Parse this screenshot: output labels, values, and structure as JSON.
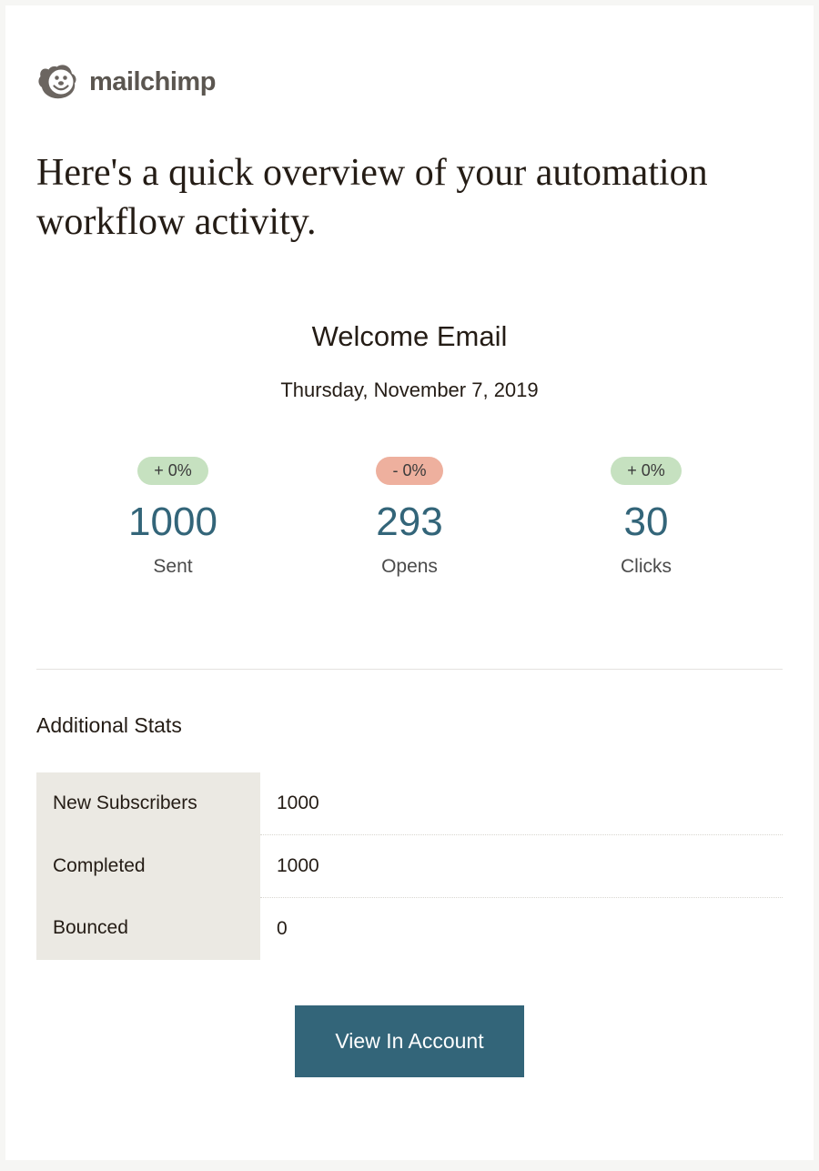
{
  "brand": {
    "name": "mailchimp",
    "icon": "monkey-icon"
  },
  "hero": "Here's a quick overview of your automation workflow activity.",
  "campaign": {
    "title": "Welcome Email",
    "date": "Thursday, November 7, 2019"
  },
  "metrics": {
    "sent": {
      "delta": "+ 0%",
      "delta_color": "green",
      "value": "1000",
      "label": "Sent"
    },
    "opens": {
      "delta": "- 0%",
      "delta_color": "red",
      "value": "293",
      "label": "Opens"
    },
    "clicks": {
      "delta": "+ 0%",
      "delta_color": "green",
      "value": "30",
      "label": "Clicks"
    }
  },
  "additional": {
    "heading": "Additional Stats",
    "rows": [
      {
        "key": "New Subscribers",
        "value": "1000"
      },
      {
        "key": "Completed",
        "value": "1000"
      },
      {
        "key": "Bounced",
        "value": "0"
      }
    ]
  },
  "cta": {
    "label": "View In Account"
  },
  "colors": {
    "accent": "#336579",
    "badge_green": "#c6e1c0",
    "badge_red": "#eeb09e"
  }
}
